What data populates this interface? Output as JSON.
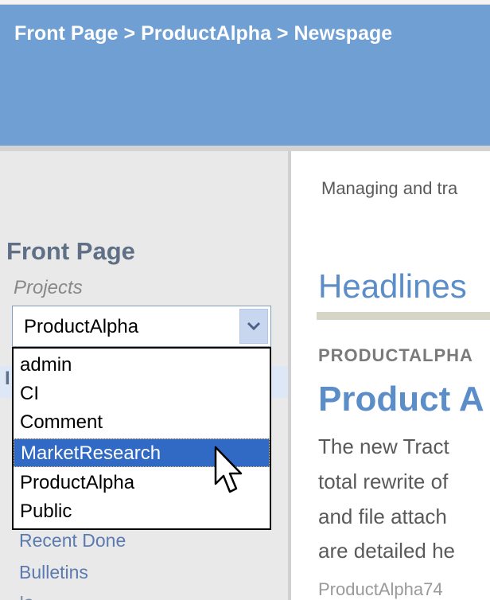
{
  "breadcrumb": {
    "item1": "Front Page",
    "sep1": " > ",
    "item2": "ProductAlpha",
    "sep2": " > ",
    "item3": "Newspage"
  },
  "sidebar": {
    "title": "Front Page",
    "projects_label": "Projects",
    "select_value": "ProductAlpha",
    "partial_item": "I",
    "options": [
      "admin",
      "CI",
      "Comment",
      "MarketResearch",
      "ProductAlpha",
      "Public"
    ],
    "highlighted_option": "MarketResearch",
    "links": [
      "Recent Done",
      "Bulletins",
      "Is..."
    ]
  },
  "main": {
    "tagline": "Managing and tra",
    "headlines": "Headlines",
    "category": "PRODUCTALPHA",
    "article_title": "Product A",
    "article_lines": [
      "The new Tract",
      "total rewrite of",
      "and file attach",
      "are detailed he"
    ],
    "byline": "ProductAlpha74"
  },
  "icons": {
    "select_arrow": "chevron-down-icon",
    "cursor": "mouse-pointer-icon"
  },
  "colors": {
    "header_bg": "#6f9fd3",
    "sidebar_bg": "#e9e9e9",
    "highlight_bg": "#316ac5",
    "link": "#5b7bb0",
    "headline": "#5b8ec9"
  }
}
